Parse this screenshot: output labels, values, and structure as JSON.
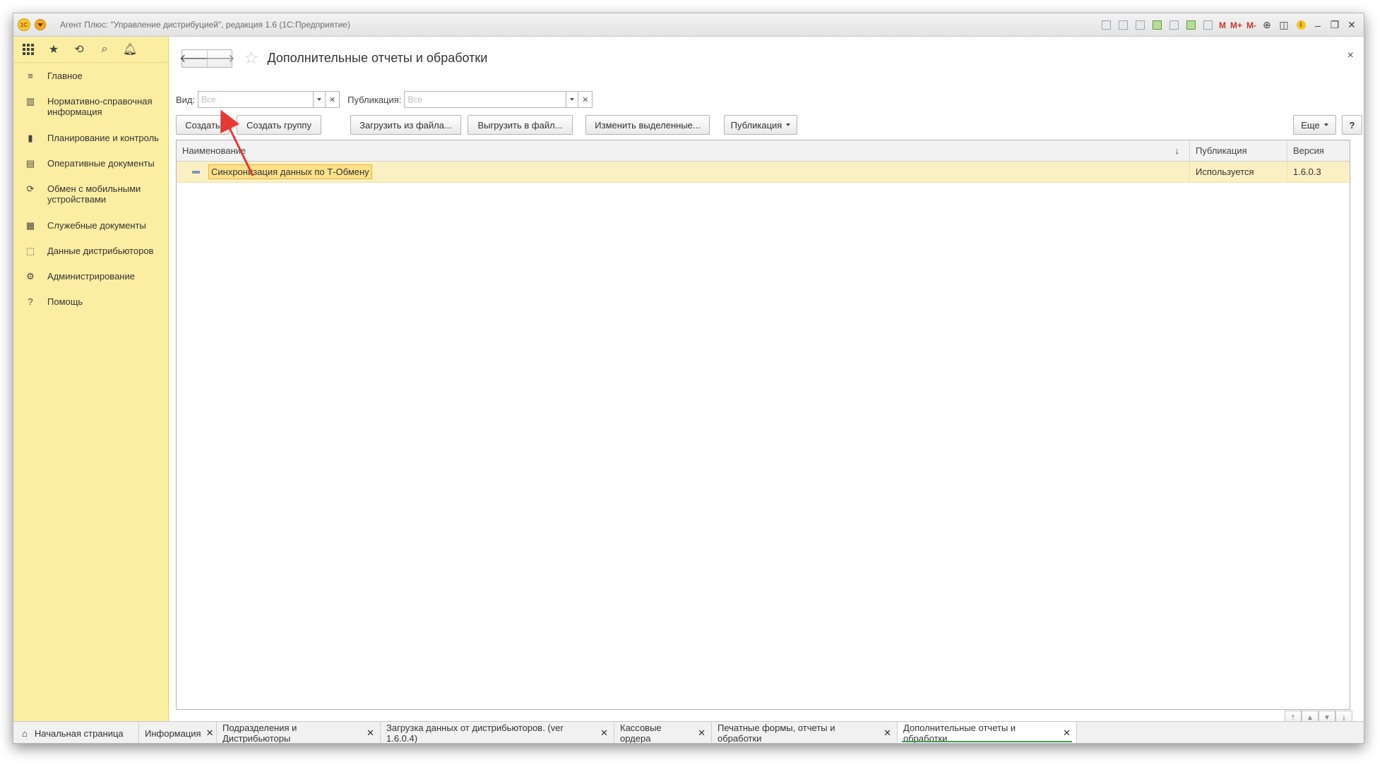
{
  "window": {
    "title": "Агент Плюс: \"Управление дистрибуцией\", редакция 1.6  (1С:Предприятие)",
    "logo_text": "1С",
    "tools": [
      "M",
      "M+",
      "M-"
    ]
  },
  "sidebar": {
    "items": [
      {
        "icon": "≡",
        "label": "Главное"
      },
      {
        "icon": "▥",
        "label": "Нормативно-справочная информация"
      },
      {
        "icon": "▮",
        "label": "Планирование и контроль"
      },
      {
        "icon": "▤",
        "label": "Оперативные документы"
      },
      {
        "icon": "⟳",
        "label": "Обмен с мобильными устройствами"
      },
      {
        "icon": "▦",
        "label": "Служебные документы"
      },
      {
        "icon": "⬚",
        "label": "Данные дистрибьюторов"
      },
      {
        "icon": "⚙",
        "label": "Администрирование"
      },
      {
        "icon": "?",
        "label": "Помощь"
      }
    ]
  },
  "form": {
    "title": "Дополнительные отчеты и обработки",
    "filters": {
      "view_label": "Вид:",
      "view_placeholder": "Все",
      "publication_label": "Публикация:",
      "publication_placeholder": "Все"
    },
    "toolbar": {
      "create": "Создать",
      "create_group": "Создать группу",
      "load_from_file": "Загрузить из файла...",
      "unload_to_file": "Выгрузить в файл...",
      "change_selected": "Изменить выделенные...",
      "publication": "Публикация",
      "more": "Еще",
      "help": "?"
    },
    "table": {
      "columns": [
        "Наименование",
        "Публикация",
        "Версия"
      ],
      "rows": [
        {
          "name": "Синхронизация данных по Т-Обмену",
          "publication": "Используется",
          "version": "1.6.0.3"
        }
      ]
    }
  },
  "tabs": [
    {
      "label": "Начальная страница",
      "closable": false
    },
    {
      "label": "Информация",
      "closable": true
    },
    {
      "label": "Подразделения и Дистрибьюторы",
      "closable": true
    },
    {
      "label": "Загрузка данных от дистрибьюторов. (ver 1.6.0.4)",
      "closable": true
    },
    {
      "label": "Кассовые ордера",
      "closable": true
    },
    {
      "label": "Печатные формы, отчеты и обработки",
      "closable": true
    },
    {
      "label": "Дополнительные отчеты и обработки",
      "closable": true,
      "active": true
    }
  ],
  "colors": {
    "sidebar_bg": "#fbeea2",
    "selected_row": "#fbf0c4",
    "annotation_arrow": "#e53935",
    "active_tab_underline": "#3aa24a"
  }
}
